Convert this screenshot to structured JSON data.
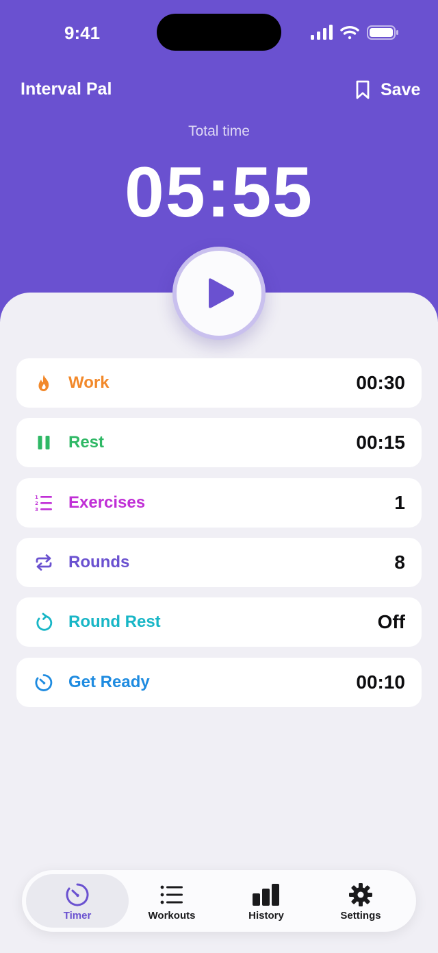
{
  "status_bar": {
    "time": "9:41"
  },
  "header": {
    "title": "Interval Pal",
    "save_label": "Save",
    "total_label": "Total time",
    "total_time": "05:55"
  },
  "settings": [
    {
      "label": "Work",
      "value": "00:30",
      "color": "#f2892b",
      "icon": "flame-icon"
    },
    {
      "label": "Rest",
      "value": "00:15",
      "color": "#2fb865",
      "icon": "pause-icon"
    },
    {
      "label": "Exercises",
      "value": "1",
      "color": "#c02fd6",
      "icon": "numbered-list-icon"
    },
    {
      "label": "Rounds",
      "value": "8",
      "color": "#6a51d0",
      "icon": "repeat-icon"
    },
    {
      "label": "Round Rest",
      "value": "Off",
      "color": "#18b6c6",
      "icon": "refresh-icon"
    },
    {
      "label": "Get Ready",
      "value": "00:10",
      "color": "#1e8be0",
      "icon": "stopwatch-icon"
    }
  ],
  "tabs": [
    {
      "label": "Timer",
      "icon": "timer-icon",
      "active": true
    },
    {
      "label": "Workouts",
      "icon": "list-icon"
    },
    {
      "label": "History",
      "icon": "bar-chart-icon"
    },
    {
      "label": "Settings",
      "icon": "gear-icon"
    }
  ],
  "colors": {
    "accent": "#6a51d0",
    "background": "#f0eff5"
  }
}
